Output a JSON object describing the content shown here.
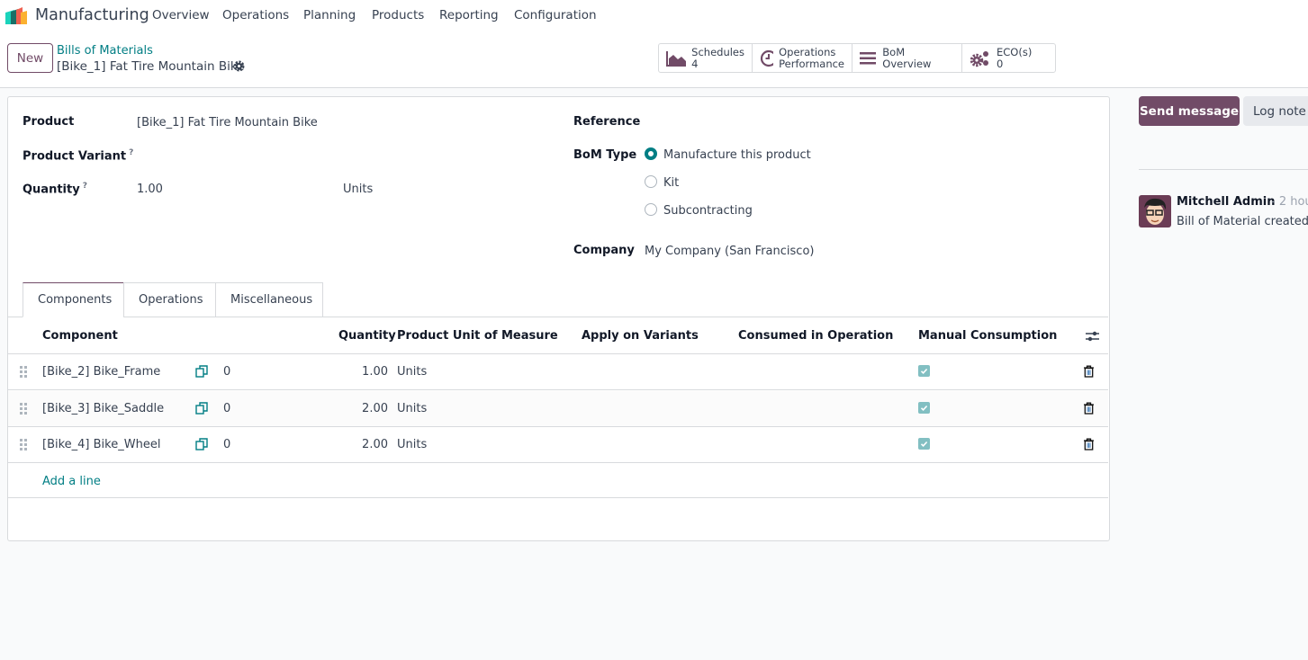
{
  "app": {
    "name": "Manufacturing",
    "menu": [
      "Overview",
      "Operations",
      "Planning",
      "Products",
      "Reporting",
      "Configuration"
    ]
  },
  "control": {
    "new_label": "New",
    "breadcrumb_parent": "Bills of Materials",
    "record_title": "[Bike_1] Fat Tire Mountain Bike",
    "smart_buttons": [
      {
        "label": "Schedules",
        "value": "4",
        "icon": "area-chart-icon"
      },
      {
        "label": "Operations",
        "label2": "Performance",
        "icon": "clock-icon"
      },
      {
        "label": "BoM Overview",
        "icon": "bars-icon"
      },
      {
        "label": "ECO(s)",
        "value": "0",
        "icon": "gears-icon"
      }
    ]
  },
  "form": {
    "product_label": "Product",
    "product": "[Bike_1] Fat Tire Mountain Bike",
    "variant_label": "Product Variant",
    "quantity_label": "Quantity",
    "quantity": "1.00",
    "uom": "Units",
    "help": "?",
    "reference_label": "Reference",
    "bom_type_label": "BoM Type",
    "bom_types": [
      "Manufacture this product",
      "Kit",
      "Subcontracting"
    ],
    "bom_type_selected": 0,
    "company_label": "Company",
    "company": "My Company (San Francisco)"
  },
  "tabs": [
    "Components",
    "Operations",
    "Miscellaneous"
  ],
  "table": {
    "headers": [
      "Component",
      "Quantity",
      "Product Unit of Measure",
      "Apply on Variants",
      "Consumed in Operation",
      "Manual Consumption"
    ],
    "rows": [
      {
        "component": "[Bike_2] Bike_Frame",
        "count": "0",
        "qty": "1.00",
        "uom": "Units",
        "manual": true
      },
      {
        "component": "[Bike_3] Bike_Saddle",
        "count": "0",
        "qty": "2.00",
        "uom": "Units",
        "manual": true
      },
      {
        "component": "[Bike_4] Bike_Wheel",
        "count": "0",
        "qty": "2.00",
        "uom": "Units",
        "manual": true
      }
    ],
    "add_line": "Add a line"
  },
  "chatter": {
    "send": "Send message",
    "log": "Log note",
    "author": "Mitchell Admin",
    "time": "- 2 hou",
    "message": "Bill of Material created"
  },
  "colors": {
    "brand": "#714b67",
    "accent": "#017e84",
    "checkbox": "#82bfc2"
  }
}
